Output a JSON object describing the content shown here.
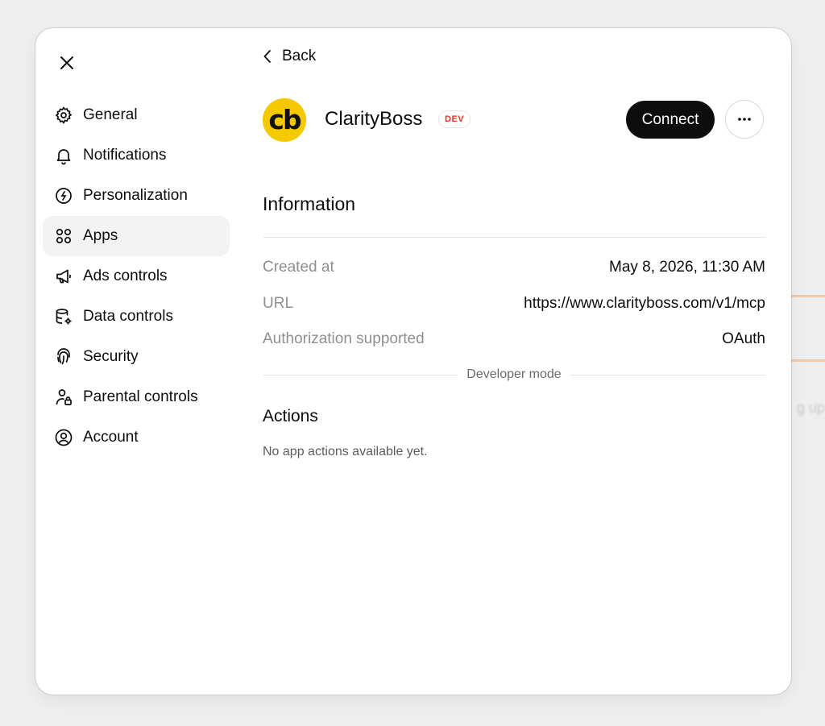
{
  "background": {
    "peek_text": "g up"
  },
  "sidebar": {
    "items": [
      {
        "label": "General",
        "icon": "gear-icon"
      },
      {
        "label": "Notifications",
        "icon": "bell-icon"
      },
      {
        "label": "Personalization",
        "icon": "personalization-icon"
      },
      {
        "label": "Apps",
        "icon": "apps-grid-icon",
        "active": true
      },
      {
        "label": "Ads controls",
        "icon": "megaphone-icon"
      },
      {
        "label": "Data controls",
        "icon": "database-gear-icon"
      },
      {
        "label": "Security",
        "icon": "fingerprint-icon"
      },
      {
        "label": "Parental controls",
        "icon": "person-lock-icon"
      },
      {
        "label": "Account",
        "icon": "user-circle-icon"
      }
    ]
  },
  "header": {
    "back_label": "Back"
  },
  "app": {
    "name": "ClarityBoss",
    "badge": "DEV",
    "logo_text": "cb",
    "logo_color": "#f5c900",
    "connect_label": "Connect"
  },
  "information": {
    "title": "Information",
    "rows": [
      {
        "key": "Created at",
        "value": "May 8, 2026, 11:30 AM"
      },
      {
        "key": "URL",
        "value": "https://www.clarityboss.com/v1/mcp"
      },
      {
        "key": "Authorization supported",
        "value": "OAuth"
      }
    ]
  },
  "developer_mode": {
    "label": "Developer mode"
  },
  "actions": {
    "title": "Actions",
    "empty_text": "No app actions available yet."
  },
  "colors": {
    "accent": "#0d0d0d",
    "badge_text": "#d6382c",
    "active_bg": "#f3f3f3"
  }
}
